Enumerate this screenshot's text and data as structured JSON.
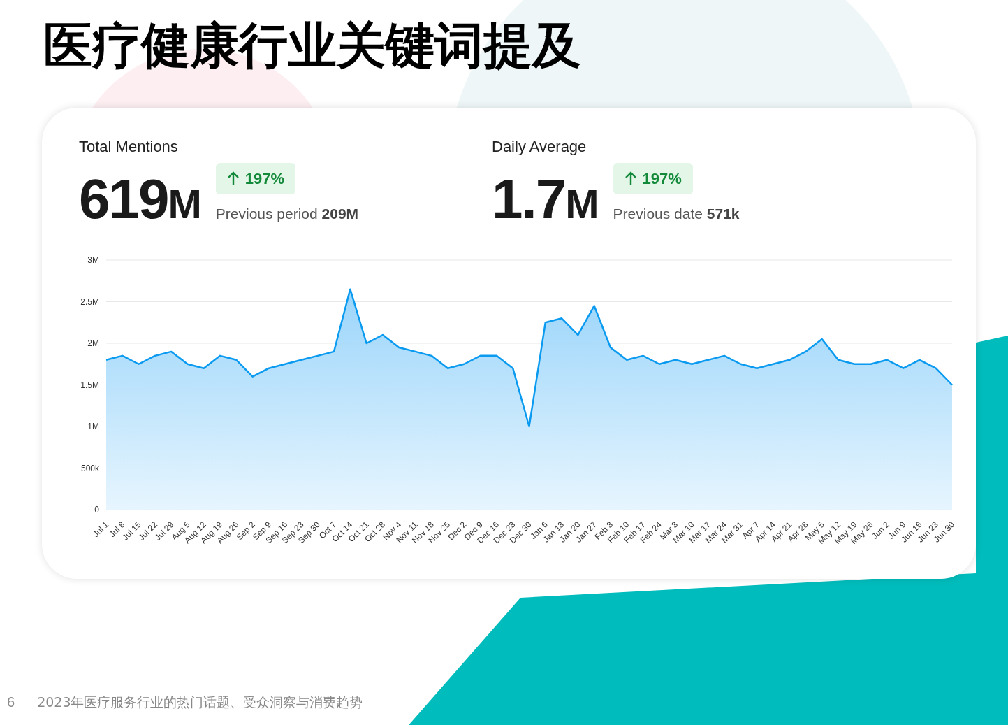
{
  "title": "医疗健康行业关键词提及",
  "stats": [
    {
      "label": "Total Mentions",
      "value": "619",
      "unit": "M",
      "change": "197%",
      "comparison_label": "Previous period",
      "comparison_value": "209M"
    },
    {
      "label": "Daily Average",
      "value": "1.7",
      "unit": "M",
      "change": "197%",
      "comparison_label": "Previous date",
      "comparison_value": "571k"
    }
  ],
  "chart_data": {
    "type": "area",
    "grid": true,
    "categories": [
      "Jul 1",
      "Jul 8",
      "Jul 15",
      "Jul 22",
      "Jul 29",
      "Aug 5",
      "Aug 12",
      "Aug 19",
      "Aug 26",
      "Sep 2",
      "Sep 9",
      "Sep 16",
      "Sep 23",
      "Sep 30",
      "Oct 7",
      "Oct 14",
      "Oct 21",
      "Oct 28",
      "Nov 4",
      "Nov 11",
      "Nov 18",
      "Nov 25",
      "Dec 2",
      "Dec 9",
      "Dec 16",
      "Dec 23",
      "Dec 30",
      "Jan 6",
      "Jan 13",
      "Jan 20",
      "Jan 27",
      "Feb 3",
      "Feb 10",
      "Feb 17",
      "Feb 24",
      "Mar 3",
      "Mar 10",
      "Mar 17",
      "Mar 24",
      "Mar 31",
      "Apr 7",
      "Apr 14",
      "Apr 21",
      "Apr 28",
      "May 5",
      "May 12",
      "May 19",
      "May 26",
      "Jun 2",
      "Jun 9",
      "Jun 16",
      "Jun 23",
      "Jun 30"
    ],
    "series": [
      {
        "color": "#0a9af0",
        "values": [
          1800000,
          1850000,
          1750000,
          1850000,
          1900000,
          1750000,
          1700000,
          1850000,
          1800000,
          1600000,
          1700000,
          1750000,
          1800000,
          1850000,
          1900000,
          2650000,
          2000000,
          2100000,
          1950000,
          1900000,
          1850000,
          1700000,
          1750000,
          1850000,
          1850000,
          1700000,
          1000000,
          2250000,
          2300000,
          2100000,
          2450000,
          1950000,
          1800000,
          1850000,
          1750000,
          1800000,
          1750000,
          1800000,
          1850000,
          1750000,
          1700000,
          1750000,
          1800000,
          1900000,
          2050000,
          1800000,
          1750000,
          1750000,
          1800000,
          1700000,
          1800000,
          1700000,
          1500000
        ]
      }
    ],
    "ylim": [
      0,
      3000000
    ],
    "yticks": [
      {
        "value": 0,
        "label": "0"
      },
      {
        "value": 500000,
        "label": "500k"
      },
      {
        "value": 1000000,
        "label": "1M"
      },
      {
        "value": 1500000,
        "label": "1.5M"
      },
      {
        "value": 2000000,
        "label": "2M"
      },
      {
        "value": 2500000,
        "label": "2.5M"
      },
      {
        "value": 3000000,
        "label": "3M"
      }
    ]
  },
  "footer": {
    "page_number": "6",
    "report_title": "2023年医疗服务行业的热门话题、受众洞察与消费趋势"
  }
}
